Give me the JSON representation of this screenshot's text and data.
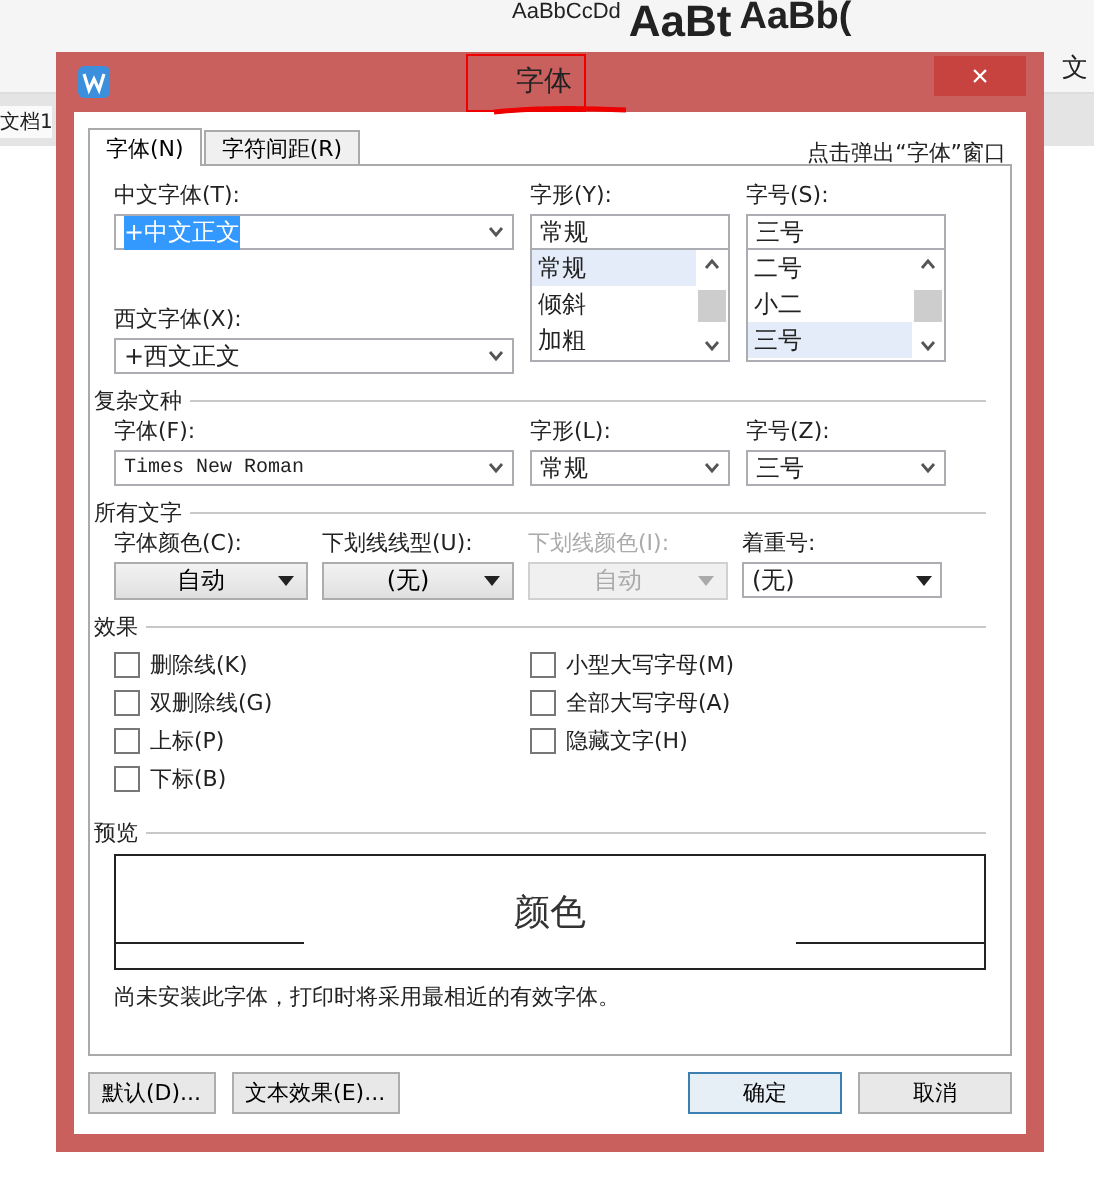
{
  "background": {
    "style_samples": [
      "AaBbCcDd",
      "AaBt",
      "AaBb("
    ],
    "document_tab": "文档1",
    "side_text": "文"
  },
  "dialog": {
    "title": "字体",
    "close": "×",
    "annotation": "点击弹出“字体”窗口",
    "tabs": [
      {
        "label": "字体(N)",
        "selected": true
      },
      {
        "label": "字符间距(R)",
        "selected": false
      }
    ],
    "chinese_font": {
      "label": "中文字体(T):",
      "value": "+中文正文"
    },
    "western_font": {
      "label": "西文字体(X):",
      "value": "+西文正文"
    },
    "font_style": {
      "label": "字形(Y):",
      "value": "常规",
      "options": [
        {
          "text": "常规",
          "selected": true
        },
        {
          "text": "倾斜",
          "selected": false
        },
        {
          "text": "加粗",
          "selected": false
        }
      ]
    },
    "font_size": {
      "label": "字号(S):",
      "value": "三号",
      "options": [
        {
          "text": "二号",
          "selected": false
        },
        {
          "text": "小二",
          "selected": false
        },
        {
          "text": "三号",
          "selected": true
        }
      ]
    },
    "complex_script": {
      "title": "复杂文种",
      "fields": [
        {
          "label": "字体(F):",
          "value": "Times New Roman"
        },
        {
          "label": "字形(L):",
          "value": "常规"
        },
        {
          "label": "字号(Z):",
          "value": "三号"
        }
      ]
    },
    "all_text": {
      "title": "所有文字",
      "fields": [
        {
          "label": "字体颜色(C):",
          "value": "自动",
          "kind": "button",
          "disabled": false
        },
        {
          "label": "下划线线型(U):",
          "value": "(无)",
          "kind": "button",
          "disabled": false
        },
        {
          "label": "下划线颜色(I):",
          "value": "自动",
          "kind": "button",
          "disabled": true
        },
        {
          "label": "着重号:",
          "value": "(无)",
          "kind": "combo",
          "disabled": false
        }
      ]
    },
    "effects": {
      "title": "效果",
      "left": [
        {
          "label": "删除线(K)",
          "checked": false
        },
        {
          "label": "双删除线(G)",
          "checked": false
        },
        {
          "label": "上标(P)",
          "checked": false
        },
        {
          "label": "下标(B)",
          "checked": false
        }
      ],
      "right": [
        {
          "label": "小型大写字母(M)",
          "checked": false
        },
        {
          "label": "全部大写字母(A)",
          "checked": false
        },
        {
          "label": "隐藏文字(H)",
          "checked": false
        }
      ]
    },
    "preview": {
      "title": "预览",
      "sample": "颜色",
      "note": "尚未安装此字体，打印时将采用最相近的有效字体。"
    },
    "left_buttons": [
      {
        "label": "默认(D)...",
        "default": false
      },
      {
        "label": "文本效果(E)...",
        "default": false
      }
    ],
    "right_buttons": [
      {
        "label": "确定",
        "default": true
      },
      {
        "label": "取消",
        "default": false
      }
    ]
  }
}
